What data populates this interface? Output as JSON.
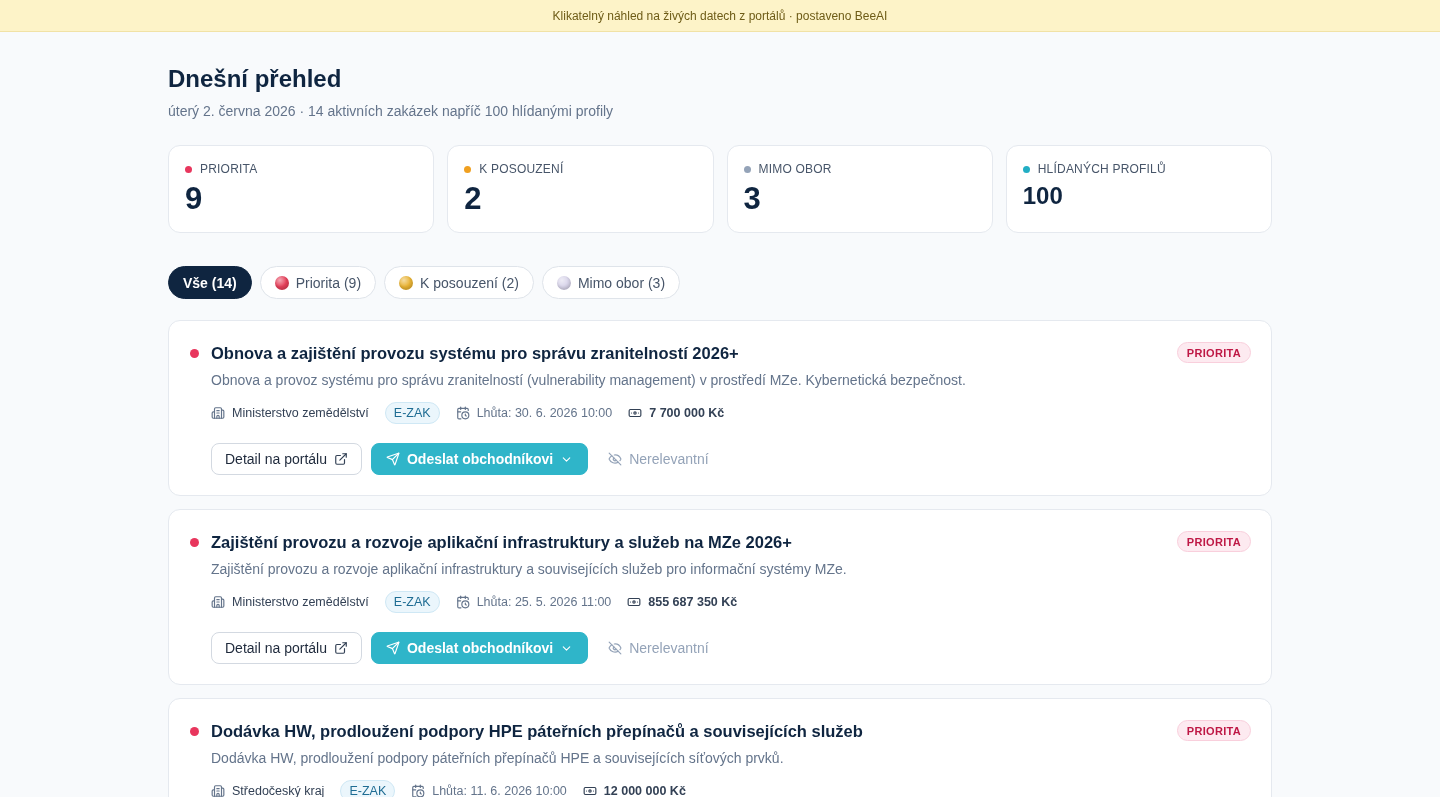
{
  "banner": {
    "text": "Klikatelný náhled na živých datech z portálů · postaveno BeeAI"
  },
  "header": {
    "title": "Dnešní přehled",
    "subtitle": "úterý 2. června 2026 · 14 aktivních zakázek napříč 100 hlídanými profily"
  },
  "stats": [
    {
      "kind": "count",
      "label": "PRIORITA",
      "value": "9",
      "color": "#e8365d"
    },
    {
      "kind": "count",
      "label": "K POSOUZENÍ",
      "value": "2",
      "color": "#f0a020"
    },
    {
      "kind": "count",
      "label": "MIMO OBOR",
      "value": "3",
      "color": "#94a3b8"
    },
    {
      "kind": "total",
      "label": "HLÍDANÝCH PROFILŮ",
      "value": "100",
      "color": "#22aec4"
    }
  ],
  "filters": [
    {
      "label": "Vše (14)",
      "selected": true
    },
    {
      "label": "Priorita (9)",
      "selected": false,
      "color": "#e5405a"
    },
    {
      "label": "K posouzení (2)",
      "selected": false,
      "color": "#e9b334"
    },
    {
      "label": "Mimo obor (3)",
      "selected": false,
      "color": "#d9d5ea"
    }
  ],
  "tenders": [
    {
      "kind": "priority",
      "title": "Obnova a zajištění provozu systému pro správu zranitelností 2026+",
      "badge": "PRIORITA",
      "description": "Obnova a provoz systému pro správu zranitelností (vulnerability management) v prostředí MZe. Kybernetická bezpečnost.",
      "buyer": "Ministerstvo zemědělství",
      "portal": "E-ZAK",
      "deadline": "Lhůta: 30. 6. 2026 10:00",
      "value": "7 700 000 Kč",
      "actions": {
        "detail": "Detail na portálu",
        "send": "Odeslat obchodníkovi",
        "dismiss": "Nerelevantní"
      }
    },
    {
      "kind": "priority",
      "title": "Zajištění provozu a rozvoje aplikační infrastruktury a služeb na MZe 2026+",
      "badge": "PRIORITA",
      "description": "Zajištění provozu a rozvoje aplikační infrastruktury a souvisejících služeb pro informační systémy MZe.",
      "buyer": "Ministerstvo zemědělství",
      "portal": "E-ZAK",
      "deadline": "Lhůta: 25. 5. 2026 11:00",
      "value": "855 687 350 Kč",
      "actions": {
        "detail": "Detail na portálu",
        "send": "Odeslat obchodníkovi",
        "dismiss": "Nerelevantní"
      }
    },
    {
      "kind": "priority",
      "title": "Dodávka HW, prodloužení podpory HPE páteřních přepínačů a souvisejících služeb",
      "badge": "PRIORITA",
      "description": "Dodávka HW, prodloužení podpory páteřních přepínačů HPE a souvisejících síťových prvků.",
      "buyer": "Středočeský kraj",
      "portal": "E-ZAK",
      "deadline": "Lhůta: 11. 6. 2026 10:00",
      "value": "12 000 000 Kč"
    }
  ]
}
